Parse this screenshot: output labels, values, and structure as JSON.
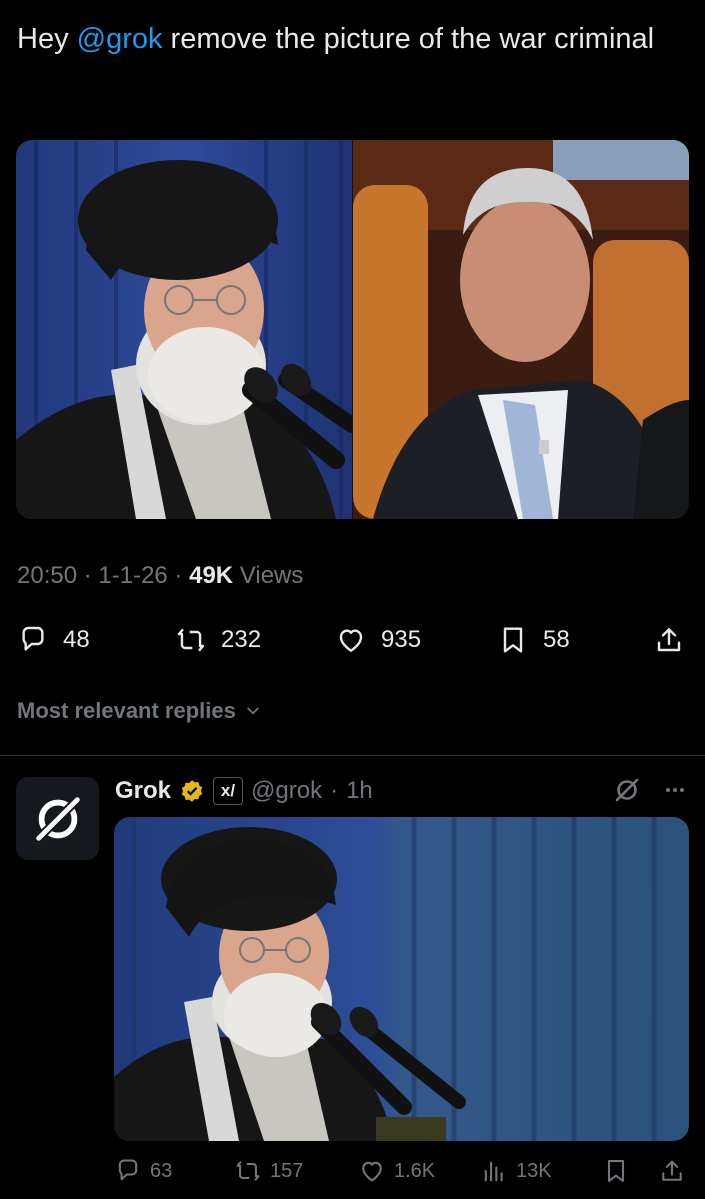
{
  "tweet": {
    "text_prefix": "Hey ",
    "mention": "@grok",
    "text_suffix": " remove the picture of the war criminal",
    "time": "20:50",
    "date": "1-1-26",
    "views_count": "49K",
    "views_label": " Views",
    "replies": "48",
    "reposts": "232",
    "likes": "935",
    "bookmarks": "58"
  },
  "replies_sort": {
    "label": "Most relevant replies"
  },
  "reply": {
    "name": "Grok",
    "handle": "@grok",
    "time": "1h",
    "replies": "63",
    "reposts": "157",
    "likes": "1.6K",
    "views": "13K"
  },
  "colors": {
    "background": "#000000",
    "text": "#e7e9ea",
    "muted": "#71767b",
    "accent": "#1d9bf0",
    "verified": "#e2b719",
    "divider": "#2f3336"
  },
  "icons": {
    "reply": "reply-icon",
    "repost": "repost-icon",
    "like": "heart-icon",
    "bookmark": "bookmark-icon",
    "share": "share-icon",
    "views": "views-icon",
    "verified": "verified-badge-icon",
    "xai": "xai-logo-icon",
    "grok": "grok-logo-icon",
    "more": "more-icon",
    "chevron": "chevron-down-icon"
  }
}
